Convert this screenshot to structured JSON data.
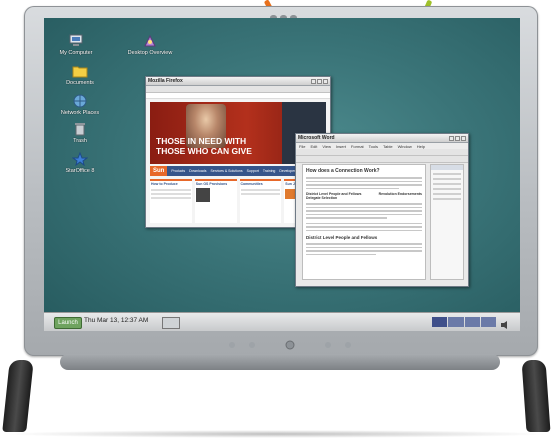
{
  "desktop": {
    "icons": [
      {
        "label": "My Computer",
        "icon": "computer-icon"
      },
      {
        "label": "Desktop Overview",
        "icon": "desktop-overview-icon"
      },
      {
        "label": "Documents",
        "icon": "folder-icon"
      },
      {
        "label": "Network Places",
        "icon": "network-icon"
      },
      {
        "label": "Trash",
        "icon": "trash-icon"
      },
      {
        "label": "StarOffice 8",
        "icon": "staroffice-icon"
      }
    ]
  },
  "browser": {
    "title": "Mozilla Firefox",
    "hero_line1": "THOSE IN NEED WITH",
    "hero_line2": "THOSE WHO CAN GIVE",
    "logo_text": "Sun",
    "nav_tabs": [
      "Products",
      "Downloads",
      "Services & Solutions",
      "Support",
      "Training",
      "Developers"
    ],
    "sections": [
      "How to Produce",
      "Sun OS Provisions",
      "Communities",
      "Sun Java Basics"
    ]
  },
  "writer": {
    "title": "Microsoft Word",
    "menus": [
      "File",
      "Edit",
      "View",
      "Insert",
      "Format",
      "Tools",
      "Table",
      "Window",
      "Help"
    ],
    "heading1": "How does a Connection Work?",
    "subheading_a": "District Level People and Fellows",
    "subheading_b": "Revolution Endorsements",
    "subheading_c": "Delegate Selection",
    "heading2": "District Level People and Fellows"
  },
  "taskbar": {
    "launch_label": "Launch",
    "datetime": "Thu Mar 13, 12:37 AM"
  },
  "colors": {
    "pointer_left": "#e8701c",
    "pointer_right": "#9fc12a",
    "desktop": "#3a7478"
  }
}
